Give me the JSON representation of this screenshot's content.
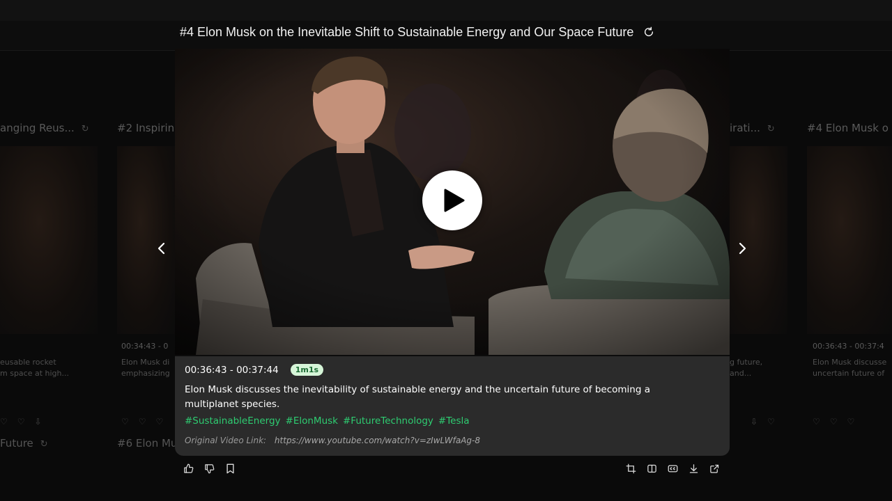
{
  "main": {
    "title": "#4 Elon Musk on the Inevitable Shift to Sustainable Energy and Our Space Future",
    "time_range": "00:36:43 - 00:37:44",
    "badge": "1m1s",
    "description": "Elon Musk discusses the inevitability of sustainable energy and the uncertain future of becoming a multiplanet species.",
    "tags": [
      "#SustainableEnergy",
      "#ElonMusk",
      "#FutureTechnology",
      "#Tesla"
    ],
    "link_label": "Original Video Link:",
    "link_url": "https://www.youtube.com/watch?v=zIwLWfaAg-8"
  },
  "background_cards": [
    {
      "title": "anging Reus...",
      "time": "",
      "desc_line1": "eusable rocket",
      "desc_line2": "m space at high..."
    },
    {
      "title": "#2 Inspirin",
      "time": "00:34:43 - 0",
      "desc_line1": "Elon Musk di",
      "desc_line2": "emphasizing"
    },
    {
      "title": "irati...",
      "time": "",
      "desc_line1": "g future,",
      "desc_line2": "and..."
    },
    {
      "title": "#4 Elon Musk o",
      "time": "00:36:43 - 00:37:4",
      "desc_line1": "Elon Musk discusse",
      "desc_line2": "uncertain future of"
    }
  ],
  "background_row2": [
    "Future",
    "#6 Elon Mu"
  ],
  "icons": {
    "refresh": "refresh-icon",
    "play": "play-icon",
    "prev": "chevron-left-icon",
    "next": "chevron-right-icon",
    "actions_left": [
      "thumbs-up-icon",
      "thumbs-down-icon",
      "bookmark-icon"
    ],
    "actions_right": [
      "crop-icon",
      "split-view-icon",
      "captions-icon",
      "download-icon",
      "share-icon"
    ]
  },
  "colors": {
    "accent_green": "#2ecc71",
    "badge_bg": "#d6f5d8",
    "badge_text": "#1c6b34",
    "info_panel": "#2b2b2b",
    "page_bg": "#0a0a0a"
  }
}
